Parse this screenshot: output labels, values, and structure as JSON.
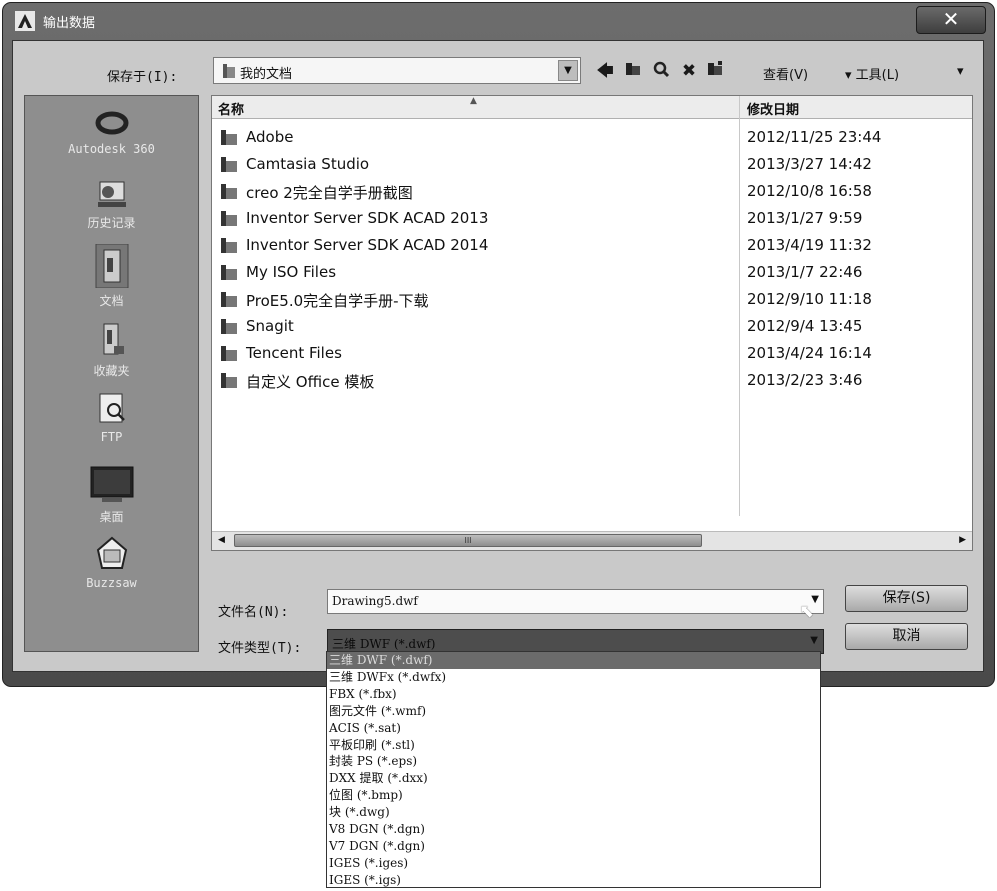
{
  "window": {
    "title": "输出数据",
    "close_label": "✕"
  },
  "toolbar": {
    "save_in_label": "保存于(I):",
    "location": "我的文档",
    "back_icon": "back-arrow-icon",
    "view_label": "查看(V)",
    "tools_label": "▾ 工具(L)",
    "more_glyph": "▾"
  },
  "places": [
    {
      "label": "Autodesk 360",
      "icon": "autodesk-360-icon"
    },
    {
      "label": "历史记录",
      "icon": "history-icon"
    },
    {
      "label": "文档",
      "icon": "documents-icon"
    },
    {
      "label": "收藏夹",
      "icon": "favorites-icon"
    },
    {
      "label": "FTP",
      "icon": "ftp-icon"
    },
    {
      "label": "桌面",
      "icon": "desktop-icon"
    },
    {
      "label": "Buzzsaw",
      "icon": "buzzsaw-icon"
    }
  ],
  "filelist": {
    "col_name": "名称",
    "col_date": "修改日期",
    "rows": [
      {
        "name": "Adobe",
        "date": "2012/11/25 23:44"
      },
      {
        "name": "Camtasia Studio",
        "date": "2013/3/27 14:42"
      },
      {
        "name": "creo 2完全自学手册截图",
        "date": "2012/10/8 16:58"
      },
      {
        "name": "Inventor Server SDK ACAD 2013",
        "date": "2013/1/27 9:59"
      },
      {
        "name": "Inventor Server SDK ACAD 2014",
        "date": "2013/4/19 11:32"
      },
      {
        "name": "My ISO Files",
        "date": "2013/1/7 22:46"
      },
      {
        "name": "ProE5.0完全自学手册-下载",
        "date": "2012/9/10 11:18"
      },
      {
        "name": "Snagit",
        "date": "2012/9/4 13:45"
      },
      {
        "name": "Tencent Files",
        "date": "2013/4/24 16:14"
      },
      {
        "name": "自定义 Office 模板",
        "date": "2013/2/23 3:46"
      }
    ],
    "scroll_grip": "III"
  },
  "form": {
    "filename_label": "文件名(N):",
    "filename_value": "Drawing5.dwf",
    "filetype_label": "文件类型(T):",
    "filetype_value": "三维 DWF (*.dwf)",
    "save_label": "保存(S)",
    "cancel_label": "取消"
  },
  "filetype_options": [
    "三维 DWF (*.dwf)",
    "三维 DWFx (*.dwfx)",
    "FBX (*.fbx)",
    "图元文件 (*.wmf)",
    "ACIS (*.sat)",
    "平板印刷 (*.stl)",
    "封装 PS (*.eps)",
    "DXX 提取 (*.dxx)",
    "位图 (*.bmp)",
    "块 (*.dwg)",
    "V8 DGN (*.dgn)",
    "V7 DGN (*.dgn)",
    "IGES (*.iges)",
    "IGES (*.igs)"
  ],
  "selected_option_index": 0
}
